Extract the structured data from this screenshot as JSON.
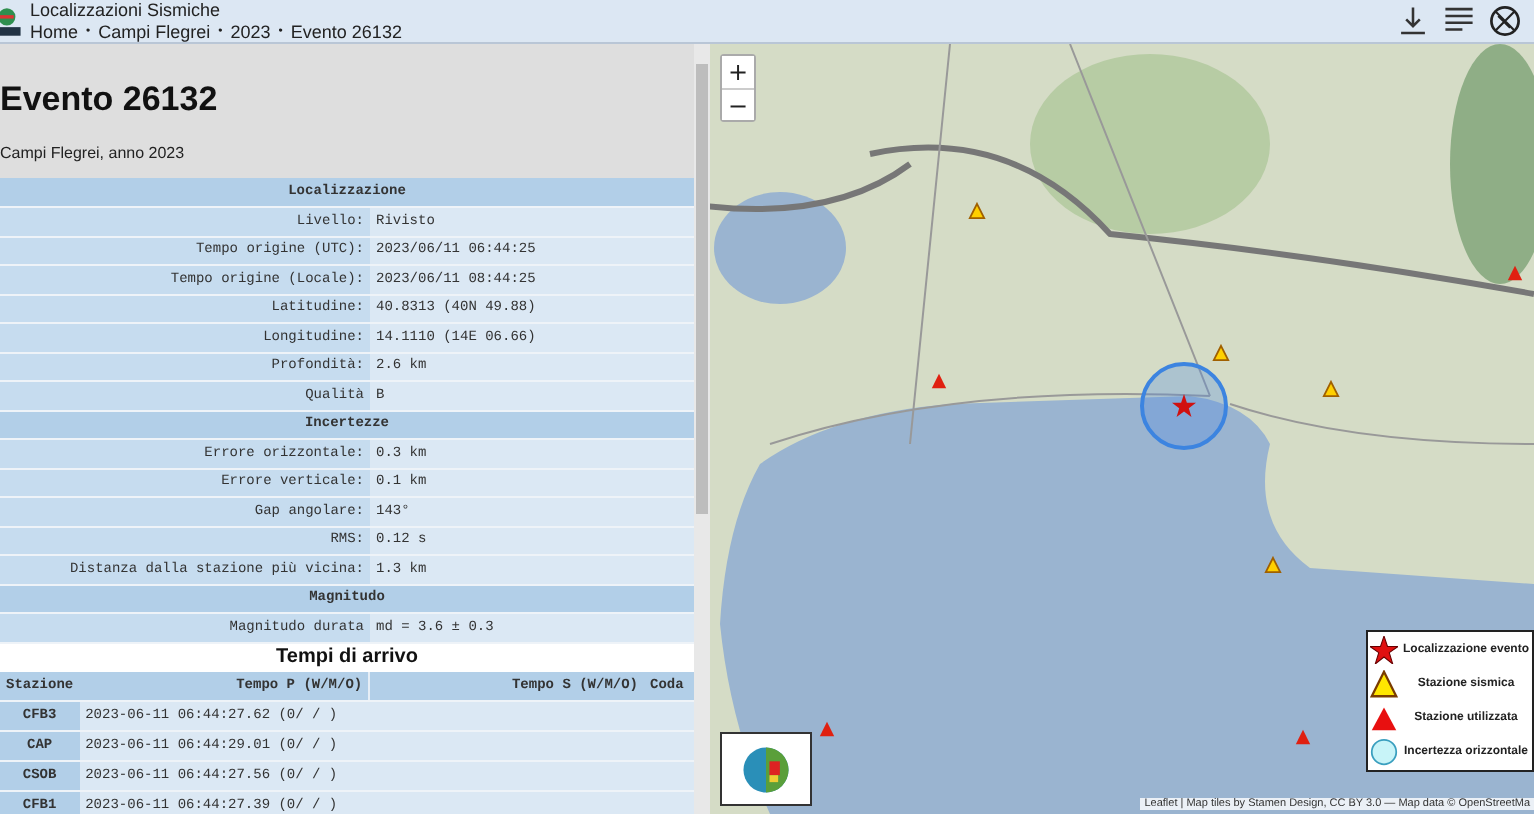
{
  "header": {
    "title": "Localizzazioni Sismiche",
    "breadcrumb": [
      {
        "kind": "link",
        "label": "Home"
      },
      {
        "kind": "separator",
        "label": "•"
      },
      {
        "kind": "link",
        "label": "Campi Flegrei"
      },
      {
        "kind": "separator",
        "label": "•"
      },
      {
        "kind": "link",
        "label": "2023"
      },
      {
        "kind": "separator",
        "label": "•"
      },
      {
        "kind": "current",
        "label": "Evento 26132"
      }
    ]
  },
  "event": {
    "title": "Evento 26132",
    "subtitle": "Campi Flegrei, anno 2023"
  },
  "details": [
    {
      "title": "Localizzazione",
      "rows": [
        {
          "label": "Livello:",
          "value": "Rivisto"
        },
        {
          "label": "Tempo origine (UTC):",
          "value": "2023/06/11 06:44:25"
        },
        {
          "label": "Tempo origine (Locale):",
          "value": "2023/06/11 08:44:25"
        },
        {
          "label": "Latitudine:",
          "value": "40.8313 (40N 49.88)"
        },
        {
          "label": "Longitudine:",
          "value": "14.1110 (14E 06.66)"
        },
        {
          "label": "Profondità:",
          "value": "2.6 km"
        },
        {
          "label": "Qualità",
          "value": "B"
        }
      ]
    },
    {
      "title": "Incertezze",
      "rows": [
        {
          "label": "Errore orizzontale:",
          "value": "0.3 km"
        },
        {
          "label": "Errore verticale:",
          "value": "0.1 km"
        },
        {
          "label": "Gap angolare:",
          "value": "143°"
        },
        {
          "label": "RMS:",
          "value": "0.12 s"
        },
        {
          "label": "Distanza dalla stazione più vicina:",
          "value": "1.3 km"
        }
      ]
    },
    {
      "title": "Magnitudo",
      "rows": [
        {
          "label": "Magnitudo durata",
          "value": "md = 3.6 ± 0.3"
        }
      ]
    }
  ],
  "arrivals": {
    "title": "Tempi di arrivo",
    "columns": [
      "Stazione",
      "Tempo P (W/M/O)",
      "Tempo S (W/M/O)",
      "Coda"
    ],
    "rows": [
      {
        "station": "CFB3",
        "p_time": "2023-06-11 06:44:27.62 (0/ / )"
      },
      {
        "station": "CAP",
        "p_time": "2023-06-11 06:44:29.01 (0/ / )"
      },
      {
        "station": "CSOB",
        "p_time": "2023-06-11 06:44:27.56 (0/ / )"
      },
      {
        "station": "CFB1",
        "p_time": "2023-06-11 06:44:27.39 (0/ / )"
      }
    ]
  },
  "map": {
    "zoom_in": "+",
    "zoom_out": "−",
    "legend": [
      {
        "kind": "star",
        "label": "Localizzazione evento"
      },
      {
        "kind": "station",
        "label": "Stazione sismica"
      },
      {
        "kind": "used",
        "label": "Stazione utilizzata"
      },
      {
        "kind": "circle",
        "label": "Incertezza orizzontale"
      }
    ],
    "attribution": "Leaflet | Map tiles by Stamen Design, CC BY 3.0 — Map data © OpenStreetMa"
  }
}
